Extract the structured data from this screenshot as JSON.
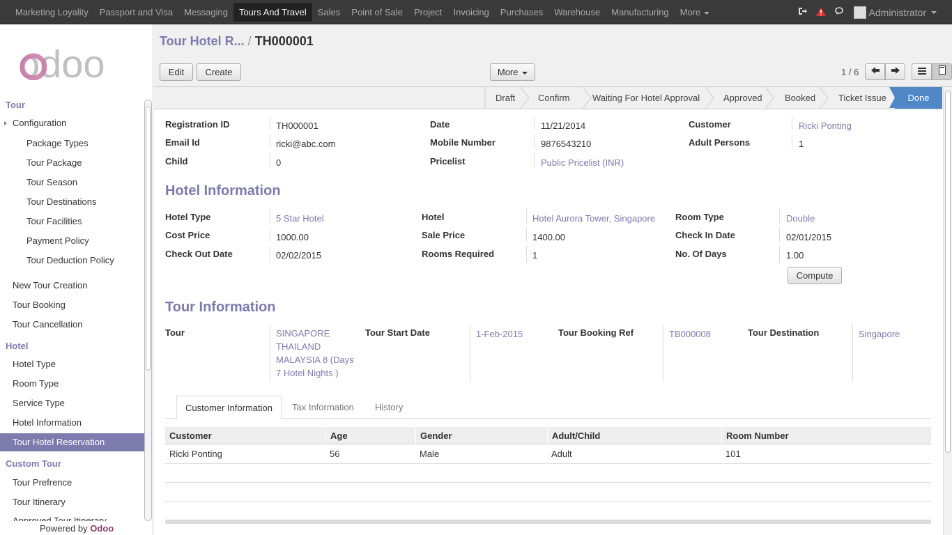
{
  "topbar": {
    "menu": [
      "Marketing Loyality",
      "Passport and Visa",
      "Messaging",
      "Tours And Travel",
      "Sales",
      "Point of Sale",
      "Project",
      "Invoicing",
      "Purchases",
      "Warehouse",
      "Manufacturing",
      "More"
    ],
    "active_menu": "Tours And Travel",
    "user": "Administrator"
  },
  "sidebar": {
    "logo": "odoo",
    "sections": [
      {
        "title": "Tour"
      },
      {
        "title": "Hotel"
      },
      {
        "title": "Custom Tour"
      }
    ],
    "tour_items": [
      "Configuration",
      "Package Types",
      "Tour Package",
      "Tour Season",
      "Tour Destinations",
      "Tour Facilities",
      "Payment Policy",
      "Tour Deduction Policy",
      "New Tour Creation",
      "Tour Booking",
      "Tour Cancellation"
    ],
    "hotel_items": [
      "Hotel Type",
      "Room Type",
      "Service Type",
      "Hotel Information",
      "Tour Hotel Reservation"
    ],
    "custom_items": [
      "Tour Prefrence",
      "Tour Itinerary",
      "Approved Tour Itinerary"
    ],
    "powered_by": "Powered by",
    "powered_brand": "Odoo"
  },
  "header": {
    "breadcrumb_parent": "Tour Hotel R...",
    "breadcrumb_sep": "/",
    "breadcrumb_current": "TH000001",
    "edit_label": "Edit",
    "create_label": "Create",
    "more_label": "More",
    "pager": "1 / 6"
  },
  "statusbar": {
    "stages": [
      "Draft",
      "Confirm",
      "Waiting For Hotel Approval",
      "Approved",
      "Booked",
      "Ticket Issue",
      "Done"
    ],
    "current": "Done"
  },
  "form": {
    "registration_id_label": "Registration ID",
    "registration_id": "TH000001",
    "date_label": "Date",
    "date": "11/21/2014",
    "customer_label": "Customer",
    "customer": "Ricki Ponting",
    "email_label": "Email Id",
    "email": "ricki@abc.com",
    "mobile_label": "Mobile Number",
    "mobile": "9876543210",
    "adult_label": "Adult Persons",
    "adult": "1",
    "child_label": "Child",
    "child": "0",
    "pricelist_label": "Pricelist",
    "pricelist": "Public Pricelist (INR)"
  },
  "hotel": {
    "title": "Hotel Information",
    "hotel_type_label": "Hotel Type",
    "hotel_type": "5 Star Hotel",
    "hotel_label": "Hotel",
    "hotel": "Hotel Aurora Tower, Singapore",
    "room_type_label": "Room Type",
    "room_type": "Double",
    "cost_label": "Cost Price",
    "cost": "1000.00",
    "sale_label": "Sale Price",
    "sale": "1400.00",
    "checkin_label": "Check In Date",
    "checkin": "02/01/2015",
    "checkout_label": "Check Out Date",
    "checkout": "02/02/2015",
    "rooms_label": "Rooms Required",
    "rooms": "1",
    "days_label": "No. Of Days",
    "days": "1.00",
    "compute_label": "Compute"
  },
  "tour": {
    "title": "Tour Information",
    "tour_label": "Tour",
    "tour": "SINGAPORE THAILAND MALAYSIA 8 (Days 7 Hotel Nights )",
    "start_label": "Tour Start Date",
    "start": "1-Feb-2015",
    "ref_label": "Tour Booking Ref",
    "ref": "TB000008",
    "dest_label": "Tour Destination",
    "dest": "Singapore"
  },
  "tabs": [
    "Customer Information",
    "Tax Information",
    "History"
  ],
  "table": {
    "columns": [
      "Customer",
      "Age",
      "Gender",
      "Adult/Child",
      "Room Number"
    ],
    "rows": [
      [
        "Ricki Ponting",
        "56",
        "Male",
        "Adult",
        "101"
      ]
    ]
  }
}
